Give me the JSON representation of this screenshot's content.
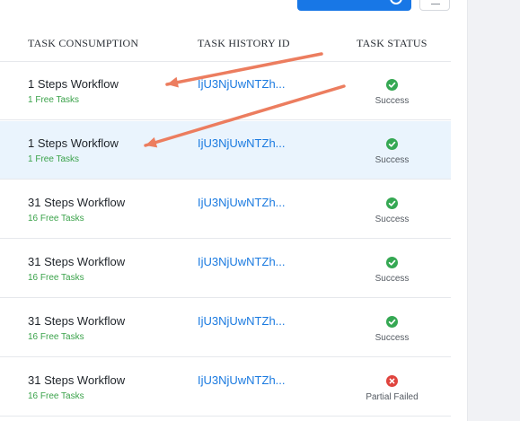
{
  "toolbar": {
    "primary_button_label": "",
    "primary_button_icon": "chevron-circle-icon",
    "secondary_button_icon": "filter-icon",
    "primary_color": "#1877e6"
  },
  "table": {
    "columns": [
      "TASK CONSUMPTION",
      "TASK HISTORY ID",
      "TASK STATUS"
    ],
    "rows": [
      {
        "workflow": "1 Steps Workflow",
        "free_tasks": "1 Free Tasks",
        "history_id": "IjU3NjUwNTZh...",
        "status": "Success",
        "status_kind": "success",
        "highlighted": false
      },
      {
        "workflow": "1 Steps Workflow",
        "free_tasks": "1 Free Tasks",
        "history_id": "IjU3NjUwNTZh...",
        "status": "Success",
        "status_kind": "success",
        "highlighted": true
      },
      {
        "workflow": "31 Steps Workflow",
        "free_tasks": "16 Free Tasks",
        "history_id": "IjU3NjUwNTZh...",
        "status": "Success",
        "status_kind": "success",
        "highlighted": false
      },
      {
        "workflow": "31 Steps Workflow",
        "free_tasks": "16 Free Tasks",
        "history_id": "IjU3NjUwNTZh...",
        "status": "Success",
        "status_kind": "success",
        "highlighted": false
      },
      {
        "workflow": "31 Steps Workflow",
        "free_tasks": "16 Free Tasks",
        "history_id": "IjU3NjUwNTZh...",
        "status": "Success",
        "status_kind": "success",
        "highlighted": false
      },
      {
        "workflow": "31 Steps Workflow",
        "free_tasks": "16 Free Tasks",
        "history_id": "IjU3NjUwNTZh...",
        "status": "Partial Failed",
        "status_kind": "failed",
        "highlighted": false
      }
    ]
  },
  "annotations": {
    "arrow_color": "#ec7d5f",
    "arrow_count": 2
  },
  "colors": {
    "success": "#35a853",
    "failed": "#e0443e",
    "link": "#1a7ae0",
    "free_tasks": "#3aa24a",
    "highlight_row": "#eaf4fd"
  }
}
